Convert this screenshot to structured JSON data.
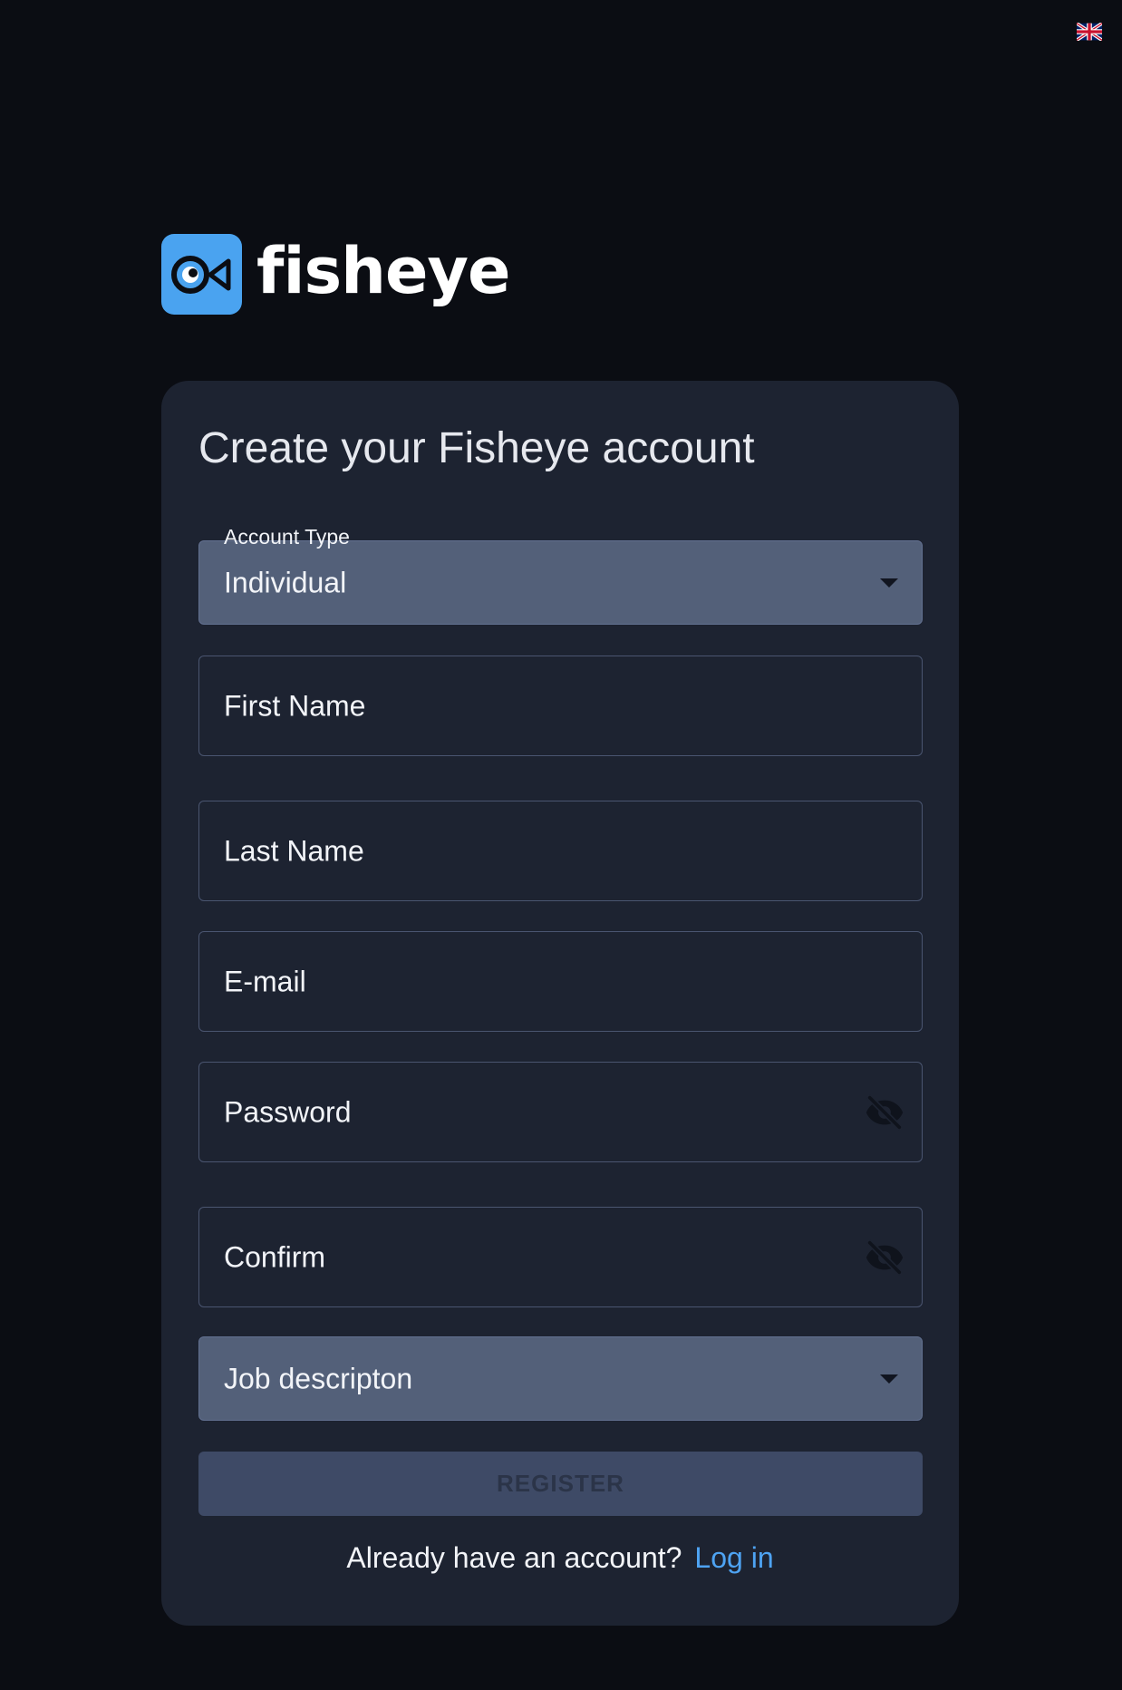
{
  "language": {
    "icon": "uk-flag-icon"
  },
  "logo": {
    "text": "fisheye",
    "icon": "fisheye-logo-icon",
    "color": "#4aa3f0"
  },
  "form": {
    "title": "Create your Fisheye account",
    "account_type": {
      "label": "Account Type",
      "value": "Individual"
    },
    "first_name": {
      "placeholder": "First Name"
    },
    "last_name": {
      "placeholder": "Last Name"
    },
    "email": {
      "placeholder": "E-mail"
    },
    "password": {
      "placeholder": "Password",
      "icon": "eye-off-icon"
    },
    "confirm": {
      "placeholder": "Confirm",
      "icon": "eye-off-icon"
    },
    "job_description": {
      "placeholder": "Job descripton"
    },
    "register_label": "REGISTER",
    "login_prompt": "Already have an account?",
    "login_link": "Log in"
  },
  "colors": {
    "background": "#0b0d13",
    "card": "#1d2331",
    "accent": "#4ea3f2",
    "select_fill": "#536079",
    "button_disabled": "#3e4a66"
  }
}
